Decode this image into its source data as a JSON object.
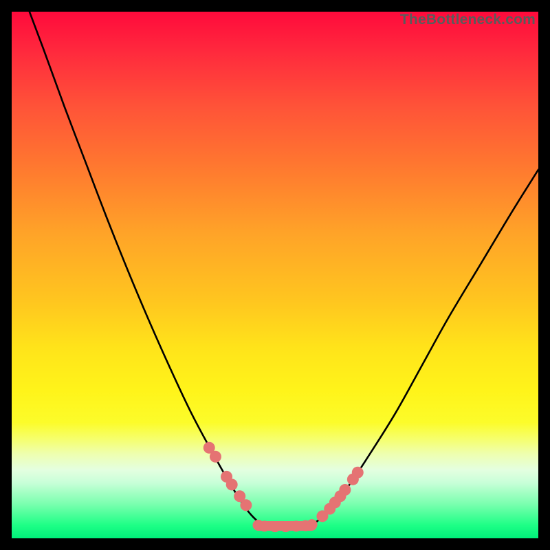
{
  "attribution": "TheBottleneck.com",
  "colors": {
    "frame": "#000000",
    "gradient_top": "#ff0a3c",
    "gradient_bottom": "#00f07a",
    "curve": "#000000",
    "marker": "#e57373"
  },
  "chart_data": {
    "type": "line",
    "title": "",
    "xlabel": "",
    "ylabel": "",
    "xlim": [
      0,
      100
    ],
    "ylim": [
      0,
      100
    ],
    "grid": false,
    "legend": false,
    "note": "Values estimated from pixels. x≈horizontal position (0–100), y≈bottleneck level (0 bottom green, 100 top red).",
    "series": [
      {
        "name": "left-curve",
        "x": [
          3,
          6,
          10,
          14,
          18,
          22,
          26,
          30,
          34,
          38,
          42,
          45,
          47.5
        ],
        "y": [
          101,
          93,
          82,
          71.5,
          61,
          51,
          41.5,
          32.5,
          24,
          16.5,
          9.5,
          5,
          2.5
        ]
      },
      {
        "name": "flat-segment",
        "x": [
          47.5,
          51,
          54,
          57
        ],
        "y": [
          2.5,
          2.2,
          2.2,
          2.5
        ]
      },
      {
        "name": "right-curve",
        "x": [
          57,
          60,
          64,
          68,
          73,
          78,
          83,
          89,
          95,
          100
        ],
        "y": [
          2.5,
          5,
          10,
          16,
          24,
          33,
          42,
          52,
          62,
          70
        ]
      }
    ],
    "markers_left": {
      "x": [
        37.5,
        38.7,
        40.8,
        41.8,
        43.3,
        44.5
      ],
      "y": [
        17.2,
        15.5,
        11.7,
        10.2,
        8.0,
        6.3
      ]
    },
    "markers_right": {
      "x": [
        59.0,
        60.4,
        61.4,
        62.4,
        63.3,
        64.8,
        65.7
      ],
      "y": [
        4.2,
        5.6,
        6.8,
        8.0,
        9.2,
        11.2,
        12.5
      ]
    },
    "flat_markers": {
      "x": [
        46.8,
        48.0,
        50.0,
        52.0,
        54.0,
        55.8,
        57.0
      ],
      "y": [
        2.5,
        2.3,
        2.2,
        2.2,
        2.3,
        2.4,
        2.6
      ]
    }
  }
}
